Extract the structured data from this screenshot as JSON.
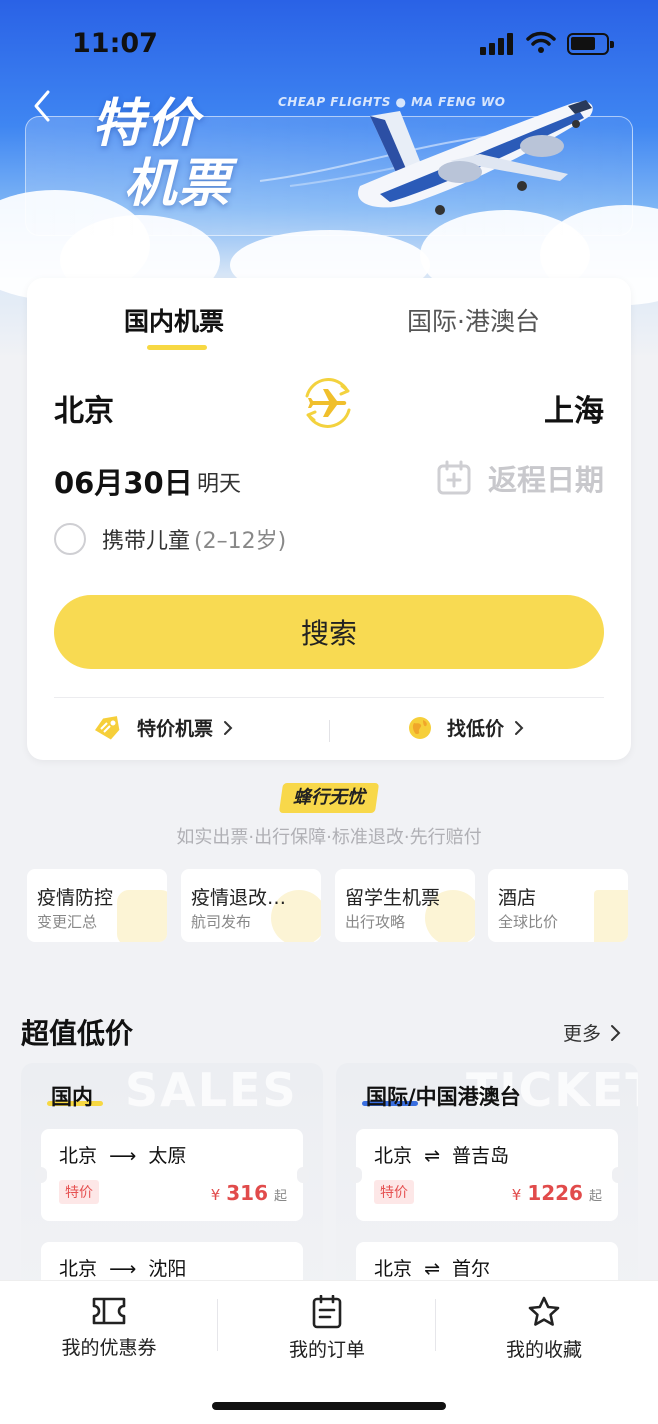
{
  "status_bar": {
    "time": "11:07"
  },
  "banner": {
    "title_line1": "特价",
    "title_line2": "机票",
    "subtitle": "CHEAP FLIGHTS  ●  MA FENG WO"
  },
  "search": {
    "tabs": [
      {
        "label": "国内机票",
        "active": true
      },
      {
        "label": "国际·港澳台",
        "active": false
      }
    ],
    "from_city": "北京",
    "to_city": "上海",
    "depart_date": "06月30日",
    "depart_hint": "明天",
    "return_placeholder": "返程日期",
    "child_option_label": "携带儿童",
    "child_option_age": "(2–12岁)",
    "child_option_checked": false,
    "search_button": "搜索",
    "quick_links": [
      {
        "label": "特价机票",
        "icon": "tag-icon"
      },
      {
        "label": "找低价",
        "icon": "globe-icon"
      }
    ]
  },
  "slogan": {
    "badge": "蜂行无忧",
    "text": "如实出票·出行保障·标准退改·先行赔付"
  },
  "services": [
    {
      "title": "疫情防控",
      "sub": "变更汇总"
    },
    {
      "title": "疫情退改…",
      "sub": "航司发布"
    },
    {
      "title": "留学生机票",
      "sub": "出行攻略"
    },
    {
      "title": "酒店",
      "sub": "全球比价"
    }
  ],
  "deals": {
    "title": "超值低价",
    "more": "更多",
    "columns": [
      {
        "title": "国内",
        "watermark": "SALES",
        "items": [
          {
            "from": "北京",
            "arrow": "⟶",
            "to": "太原",
            "tag": "特价",
            "currency": "¥",
            "price": "316",
            "suffix": "起"
          },
          {
            "from": "北京",
            "arrow": "⟶",
            "to": "沈阳"
          }
        ]
      },
      {
        "title": "国际/中国港澳台",
        "watermark": "TICKET",
        "items": [
          {
            "from": "北京",
            "arrow": "⇌",
            "to": "普吉岛",
            "tag": "特价",
            "currency": "¥",
            "price": "1226",
            "suffix": "起"
          },
          {
            "from": "北京",
            "arrow": "⇌",
            "to": "首尔"
          }
        ]
      }
    ]
  },
  "bottom_nav": [
    {
      "label": "我的优惠券",
      "icon": "coupon-icon"
    },
    {
      "label": "我的订单",
      "icon": "order-icon"
    },
    {
      "label": "我的收藏",
      "icon": "star-icon"
    }
  ],
  "colors": {
    "accent_yellow": "#f8da52",
    "price_red": "#e14b4b",
    "hero_blue": "#2a62e6",
    "domestic_underline": "#f7d843",
    "intl_underline": "#3a6fe0"
  }
}
